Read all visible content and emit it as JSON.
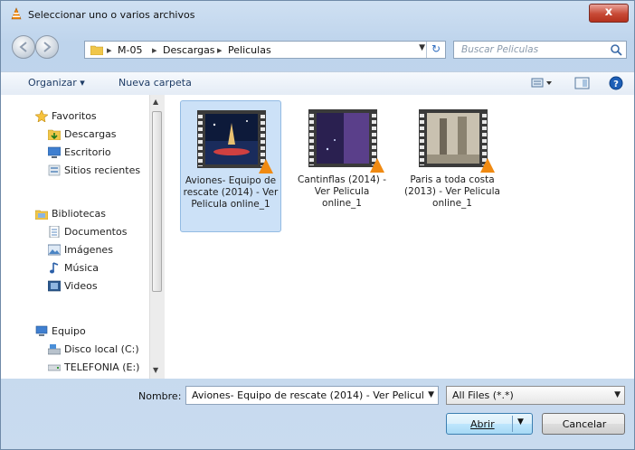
{
  "window": {
    "title": "Seleccionar uno o varios archivos",
    "close_label": "x"
  },
  "address": {
    "crumbs": [
      "M-05",
      "Descargas",
      "Peliculas"
    ],
    "separator": "▸",
    "refresh_glyph": "↻"
  },
  "search": {
    "placeholder": "Buscar Peliculas"
  },
  "toolbar": {
    "organize_label": "Organizar ▾",
    "new_folder_label": "Nueva carpeta"
  },
  "sidebar": {
    "items": [
      {
        "label": "Favoritos",
        "icon": "star-icon"
      },
      {
        "label": "Descargas",
        "icon": "downloads-icon"
      },
      {
        "label": "Escritorio",
        "icon": "desktop-icon"
      },
      {
        "label": "Sitios recientes",
        "icon": "recent-places-icon"
      },
      {
        "label": "Bibliotecas",
        "icon": "libraries-icon"
      },
      {
        "label": "Documentos",
        "icon": "documents-icon"
      },
      {
        "label": "Imágenes",
        "icon": "pictures-icon"
      },
      {
        "label": "Música",
        "icon": "music-icon"
      },
      {
        "label": "Videos",
        "icon": "videos-icon"
      },
      {
        "label": "Equipo",
        "icon": "computer-icon"
      },
      {
        "label": "Disco local (C:)",
        "icon": "local-disk-icon"
      },
      {
        "label": "TELEFONIA (E:)",
        "icon": "removable-drive-icon"
      }
    ]
  },
  "files": [
    {
      "name": "Aviones- Equipo de rescate (2014) - Ver Pelicula online_1",
      "selected": true
    },
    {
      "name": "Cantinflas (2014) - Ver Pelicula online_1",
      "selected": false
    },
    {
      "name": "Paris a toda costa (2013) - Ver Pelicula online_1",
      "selected": false
    }
  ],
  "footer": {
    "filename_label": "Nombre:",
    "filename_value": "Aviones- Equipo de rescate (2014) - Ver Pelicul",
    "filetype_value": "All Files (*.*)",
    "open_label": "Abrir",
    "cancel_label": "Cancelar"
  },
  "colors": {
    "selection": "#cce1f7",
    "vlc_cone": "#f08a12",
    "title_close": "#c74a36"
  }
}
